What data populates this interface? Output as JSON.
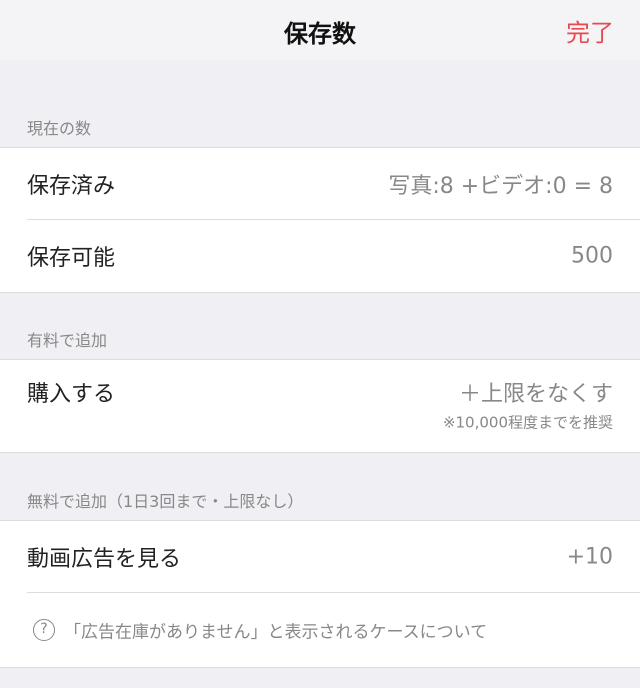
{
  "navbar": {
    "title": "保存数",
    "done_label": "完了"
  },
  "current": {
    "header": "現在の数",
    "saved_label": "保存済み",
    "saved_value": "写真:8 +ビデオ:0 = 8",
    "capacity_label": "保存可能",
    "capacity_value": "500"
  },
  "paid": {
    "header": "有料で追加",
    "purchase_label": "購入する",
    "purchase_value": "＋上限をなくす",
    "purchase_note": "※10,000程度までを推奨"
  },
  "free": {
    "header": "無料で追加（1日3回まで・上限なし）",
    "video_ad_label": "動画広告を見る",
    "video_ad_value": "+10",
    "help_icon": "?",
    "help_text": "「広告在庫がありません」と表示されるケースについて"
  },
  "colors": {
    "accent": "#e8484f",
    "background": "#efeff4",
    "secondary_text": "#888888"
  },
  "icons": {
    "help": "question-circle-icon"
  }
}
